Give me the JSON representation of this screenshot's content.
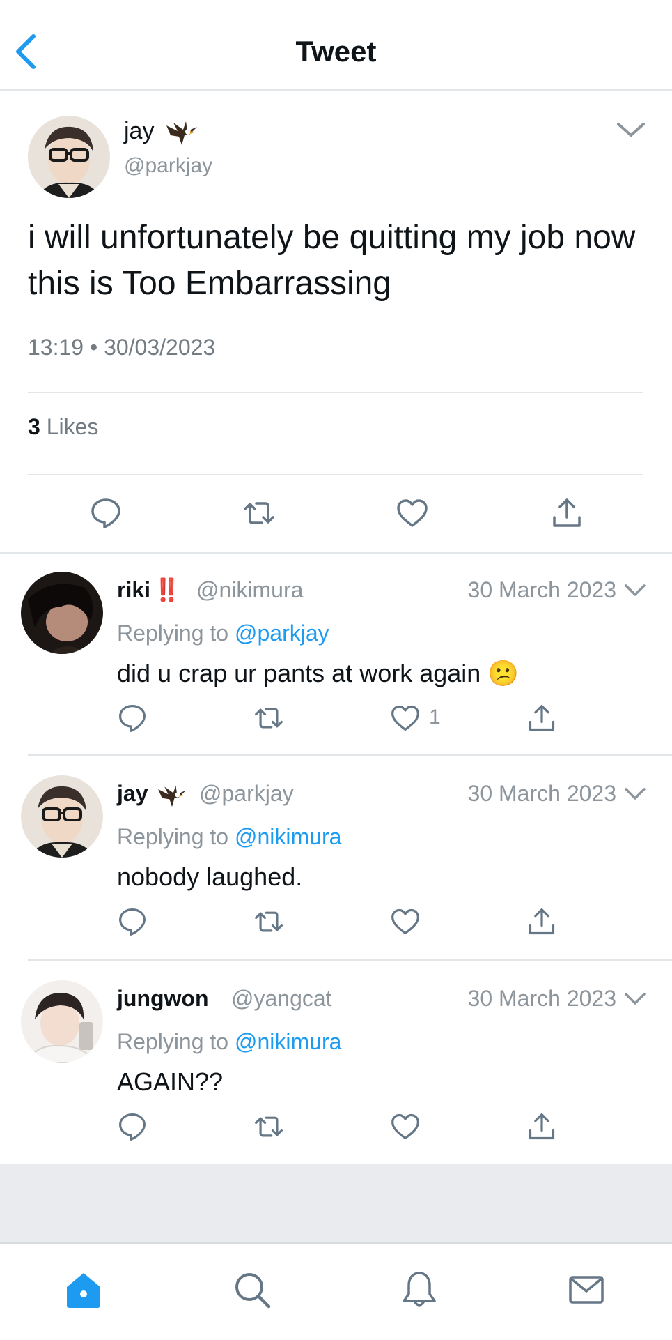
{
  "header": {
    "title": "Tweet"
  },
  "main_tweet": {
    "name": "jay",
    "handle": "@parkjay",
    "text": "i will unfortunately be quitting my job now this is Too Embarrassing",
    "timestamp": "13:19 • 30/03/2023",
    "likes_count": "3",
    "likes_label": "Likes"
  },
  "replies": [
    {
      "name": "riki",
      "badge": "‼️",
      "handle": "@nikimura",
      "date": "30 March 2023",
      "replying_prefix": "Replying to ",
      "replying_to": "@parkjay",
      "text": "did u crap ur pants at work again 😕",
      "like_count": "1"
    },
    {
      "name": "jay",
      "badge": "🦅",
      "handle": "@parkjay",
      "date": "30 March 2023",
      "replying_prefix": "Replying to ",
      "replying_to": "@nikimura",
      "text": "nobody laughed."
    },
    {
      "name": "jungwon",
      "handle": "@yangcat",
      "date": "30 March 2023",
      "replying_prefix": "Replying to ",
      "replying_to": "@nikimura",
      "text": "AGAIN??"
    }
  ],
  "tabbar": {
    "items": [
      "home-icon",
      "search-icon",
      "notifications-icon",
      "messages-icon"
    ]
  },
  "colors": {
    "accent": "#1d9bf0",
    "muted": "#8d959c",
    "icon": "#657786"
  }
}
